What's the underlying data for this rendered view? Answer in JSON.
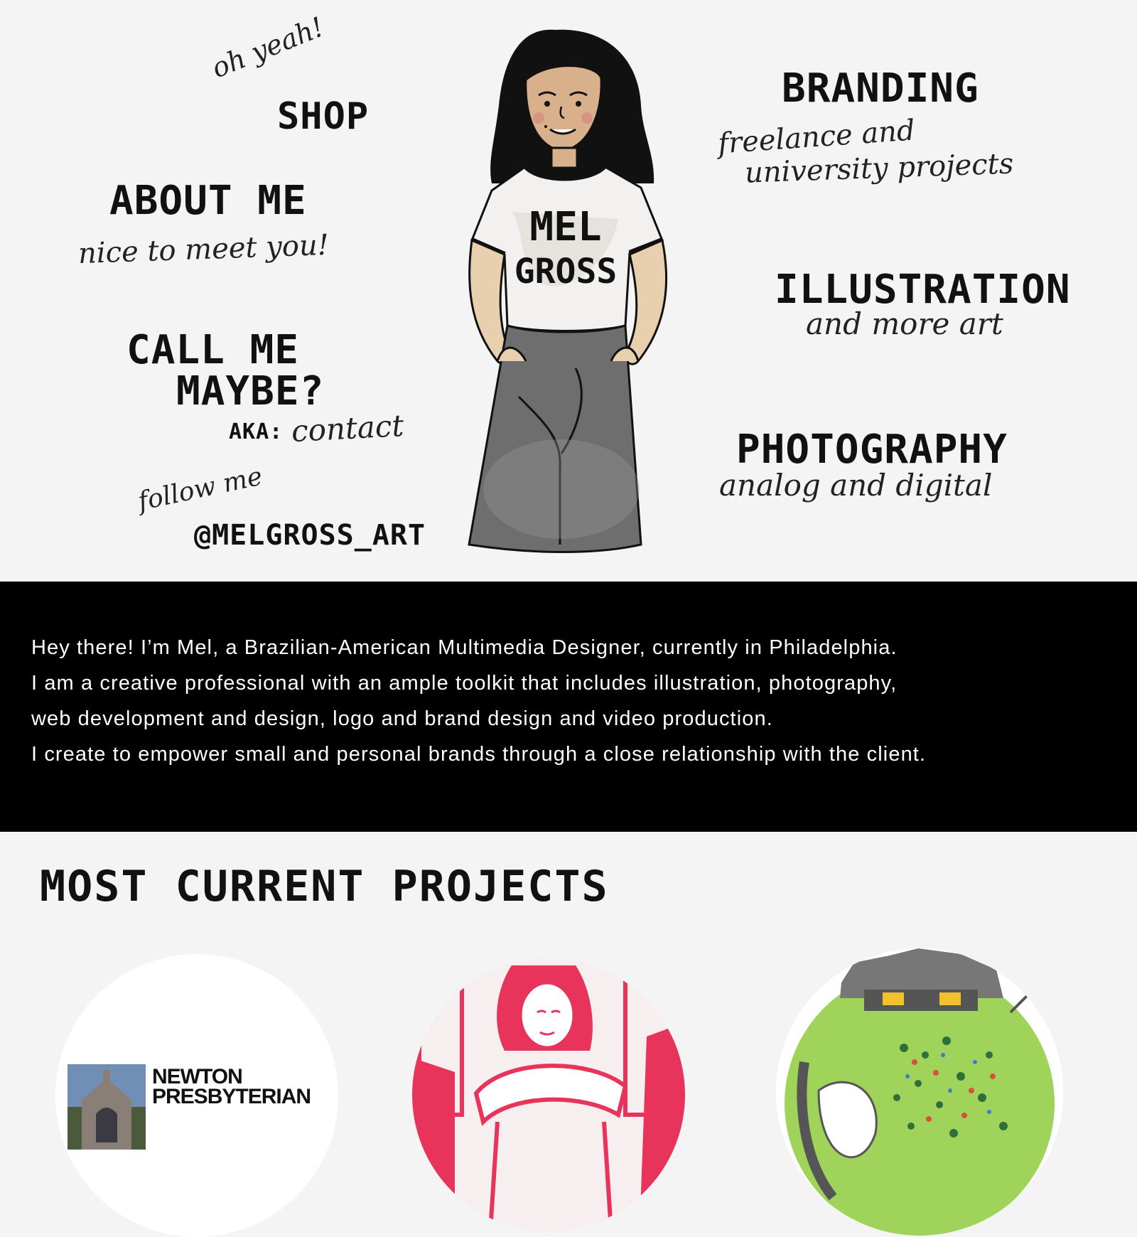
{
  "hero": {
    "nav": {
      "shop": {
        "script": "oh yeah!",
        "label": "SHOP"
      },
      "about": {
        "label": "ABOUT ME",
        "script": "nice to meet you!"
      },
      "contact": {
        "label_line1": "CALL ME",
        "label_line2": "MAYBE?",
        "aka": "AKA:",
        "script": "contact"
      },
      "social": {
        "script": "follow me",
        "handle": "@MELGROSS_ART"
      },
      "branding": {
        "label": "BRANDING",
        "script_line1": "freelance and",
        "script_line2": "university projects"
      },
      "illustration": {
        "label": "ILLUSTRATION",
        "script": "and more art"
      },
      "photography": {
        "label": "PHOTOGRAPHY",
        "script": "analog and digital"
      }
    },
    "avatar": {
      "shirt_line1": "MEL",
      "shirt_line2": "GROSS"
    }
  },
  "bio": {
    "lines": [
      "Hey there! I’m Mel, a Brazilian-American Multimedia Designer, currently in Philadelphia.",
      "I am a creative professional with an ample toolkit that includes illustration, photography,",
      "web development and design, logo and brand design and video production.",
      "I create to empower small and personal brands through a close relationship with the client."
    ]
  },
  "projects": {
    "title": "MOST CURRENT PROJECTS",
    "cards": [
      {
        "id": "newton",
        "name_line1": "NEWTON",
        "name_line2": "PRESBYTERIAN"
      },
      {
        "id": "illustration-girl"
      },
      {
        "id": "festival-map"
      }
    ]
  },
  "colors": {
    "background": "#f4f4f4",
    "bio_band": "#000000",
    "ink": "#111111",
    "pink": "#e8335a",
    "skirt_gray": "#6e6e6e",
    "grass_green": "#9fd35a"
  },
  "icons": {
    "avatar": "self-portrait-illustration"
  }
}
